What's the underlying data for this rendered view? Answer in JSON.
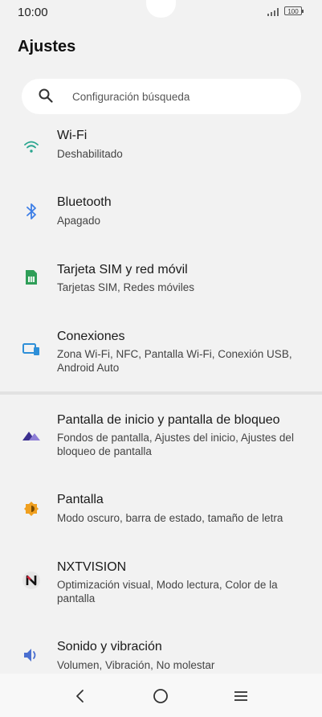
{
  "status_bar": {
    "time": "10:00",
    "battery": "100"
  },
  "page_title": "Ajustes",
  "search": {
    "placeholder": "Configuración búsqueda"
  },
  "items": [
    {
      "title": "Wi-Fi",
      "subtitle": "Deshabilitado",
      "icon": "wifi-icon",
      "color": "#2aa58f"
    },
    {
      "title": "Bluetooth",
      "subtitle": "Apagado",
      "icon": "bluetooth-icon",
      "color": "#3d7ee6"
    },
    {
      "title": "Tarjeta SIM y red móvil",
      "subtitle": "Tarjetas SIM, Redes móviles",
      "icon": "sim-card-icon",
      "color": "#2f9e58"
    },
    {
      "title": "Conexiones",
      "subtitle": "Zona Wi-Fi, NFC, Pantalla Wi-Fi, Conexión USB, Android Auto",
      "icon": "connections-icon",
      "color": "#2e8fd8"
    },
    {
      "title": "Pantalla de inicio y pantalla de bloqueo",
      "subtitle": "Fondos de pantalla, Ajustes del inicio, Ajustes del bloqueo de pantalla",
      "icon": "home-lock-screen-icon",
      "color": "#5b4aa8"
    },
    {
      "title": "Pantalla",
      "subtitle": "Modo oscuro, barra de estado, tamaño de letra",
      "icon": "display-brightness-icon",
      "color": "#f0a020"
    },
    {
      "title": "NXTVISION",
      "subtitle": "Optimización visual, Modo lectura, Color de la pantalla",
      "icon": "nxtvision-icon",
      "color": "#d7263d"
    },
    {
      "title": "Sonido y vibración",
      "subtitle": "Volumen, Vibración, No molestar",
      "icon": "speaker-icon",
      "color": "#4a6fd0"
    }
  ]
}
